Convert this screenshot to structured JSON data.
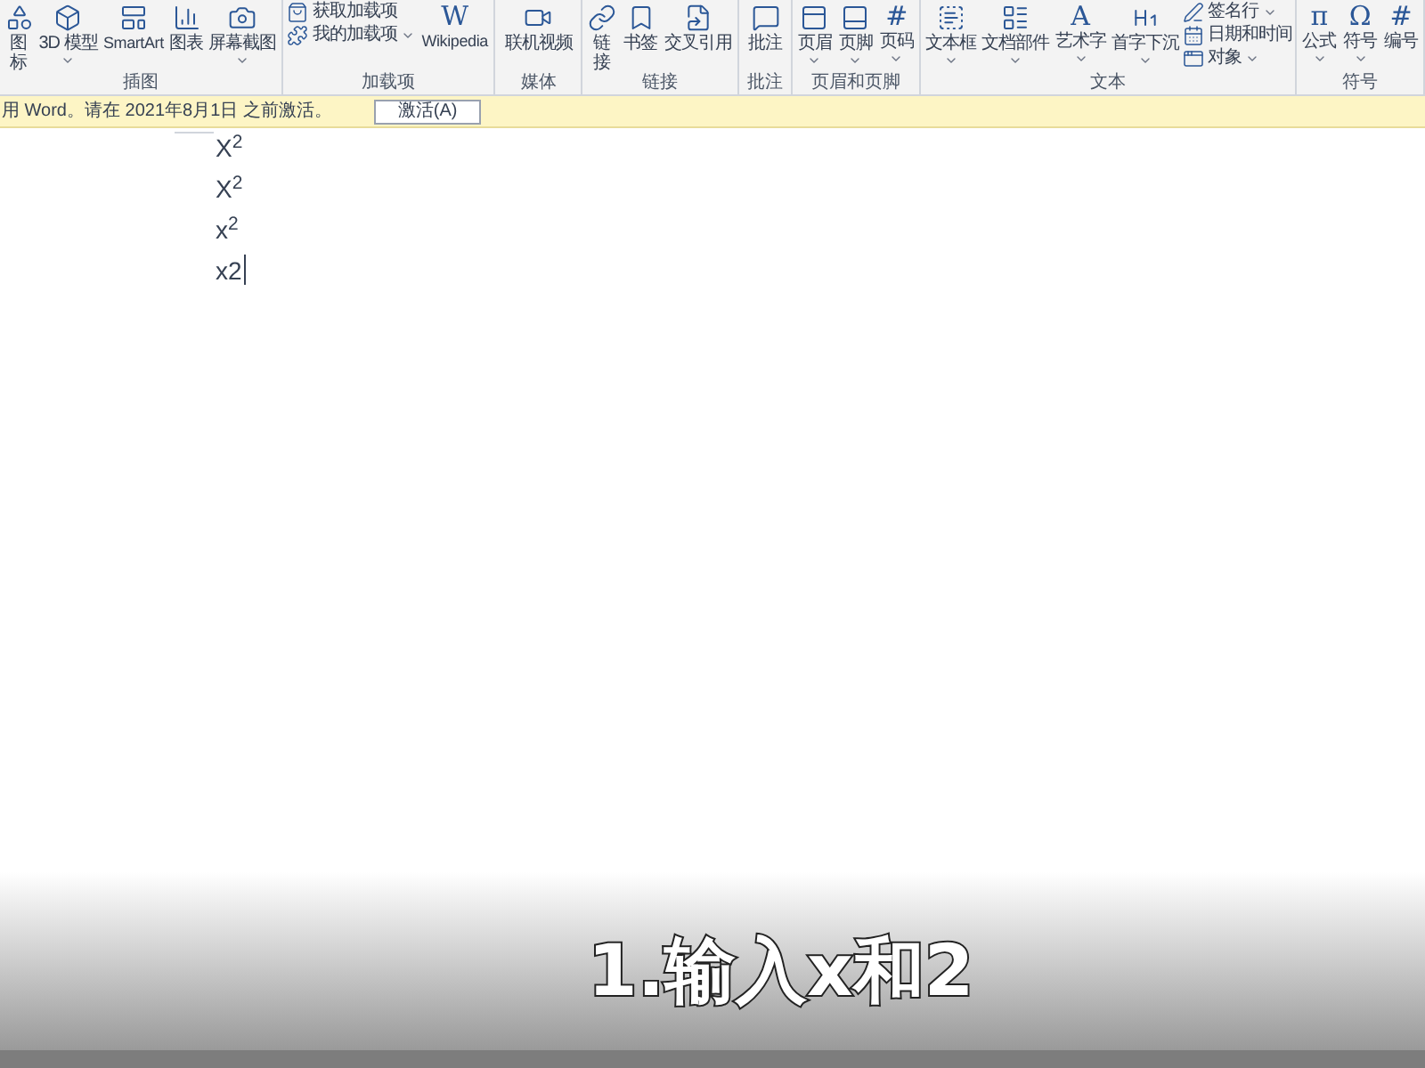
{
  "ribbon": {
    "groups": [
      {
        "label": "插图",
        "items": [
          {
            "kind": "narrow",
            "label": "图标",
            "dropdown": false
          },
          {
            "kind": "large",
            "label": "3D 模型",
            "dropdown": true
          },
          {
            "kind": "large",
            "label": "SmartArt",
            "dropdown": false
          },
          {
            "kind": "large",
            "label": "图表",
            "dropdown": false
          },
          {
            "kind": "large",
            "label": "屏幕截图",
            "dropdown": true
          }
        ]
      },
      {
        "label": "加载项",
        "items": [
          {
            "kind": "stack",
            "items": [
              {
                "label": "获取加载项",
                "dropdown": false
              },
              {
                "label": "我的加载项",
                "dropdown": true
              }
            ]
          },
          {
            "kind": "large",
            "label": "Wikipedia",
            "glyph": "W",
            "dropdown": false
          }
        ]
      },
      {
        "label": "媒体",
        "items": [
          {
            "kind": "large",
            "label": "联机视频",
            "dropdown": false
          }
        ]
      },
      {
        "label": "链接",
        "items": [
          {
            "kind": "narrow",
            "label": "链接",
            "dropdown": false
          },
          {
            "kind": "large",
            "label": "书签",
            "dropdown": false
          },
          {
            "kind": "large",
            "label": "交叉引用",
            "dropdown": false
          }
        ]
      },
      {
        "label": "批注",
        "items": [
          {
            "kind": "large",
            "label": "批注",
            "dropdown": false
          }
        ]
      },
      {
        "label": "页眉和页脚",
        "items": [
          {
            "kind": "large",
            "label": "页眉",
            "dropdown": true
          },
          {
            "kind": "large",
            "label": "页脚",
            "dropdown": true
          },
          {
            "kind": "large",
            "label": "页码",
            "glyph": "#",
            "dropdown": true
          }
        ]
      },
      {
        "label": "文本",
        "items": [
          {
            "kind": "large",
            "label": "文本框",
            "dropdown": true
          },
          {
            "kind": "large",
            "label": "文档部件",
            "dropdown": true
          },
          {
            "kind": "large",
            "label": "艺术字",
            "glyph": "A",
            "dropdown": true
          },
          {
            "kind": "large",
            "label": "首字下沉",
            "dropdown": true
          },
          {
            "kind": "stack",
            "items": [
              {
                "label": "签名行",
                "dropdown": true
              },
              {
                "label": "日期和时间",
                "dropdown": false
              },
              {
                "label": "对象",
                "dropdown": true
              }
            ]
          }
        ]
      },
      {
        "label": "符号",
        "items": [
          {
            "kind": "large",
            "label": "公式",
            "glyph": "π",
            "dropdown": true
          },
          {
            "kind": "large",
            "label": "符号",
            "glyph": "Ω",
            "dropdown": true
          },
          {
            "kind": "large",
            "label": "编号",
            "glyph": "#",
            "dropdown": false
          }
        ]
      }
    ]
  },
  "message_bar": {
    "text": "用 Word。请在 2021年8月1日 之前激活。",
    "button": "激活(A)"
  },
  "document": {
    "lines": [
      {
        "text": "X$^{2}$",
        "cursor": false
      },
      {
        "text": "X$^{2}$",
        "cursor": false
      },
      {
        "text": "x$^{2}$",
        "cursor": false
      },
      {
        "text": "x2",
        "cursor": true
      }
    ]
  },
  "caption": "1.输入x和2"
}
